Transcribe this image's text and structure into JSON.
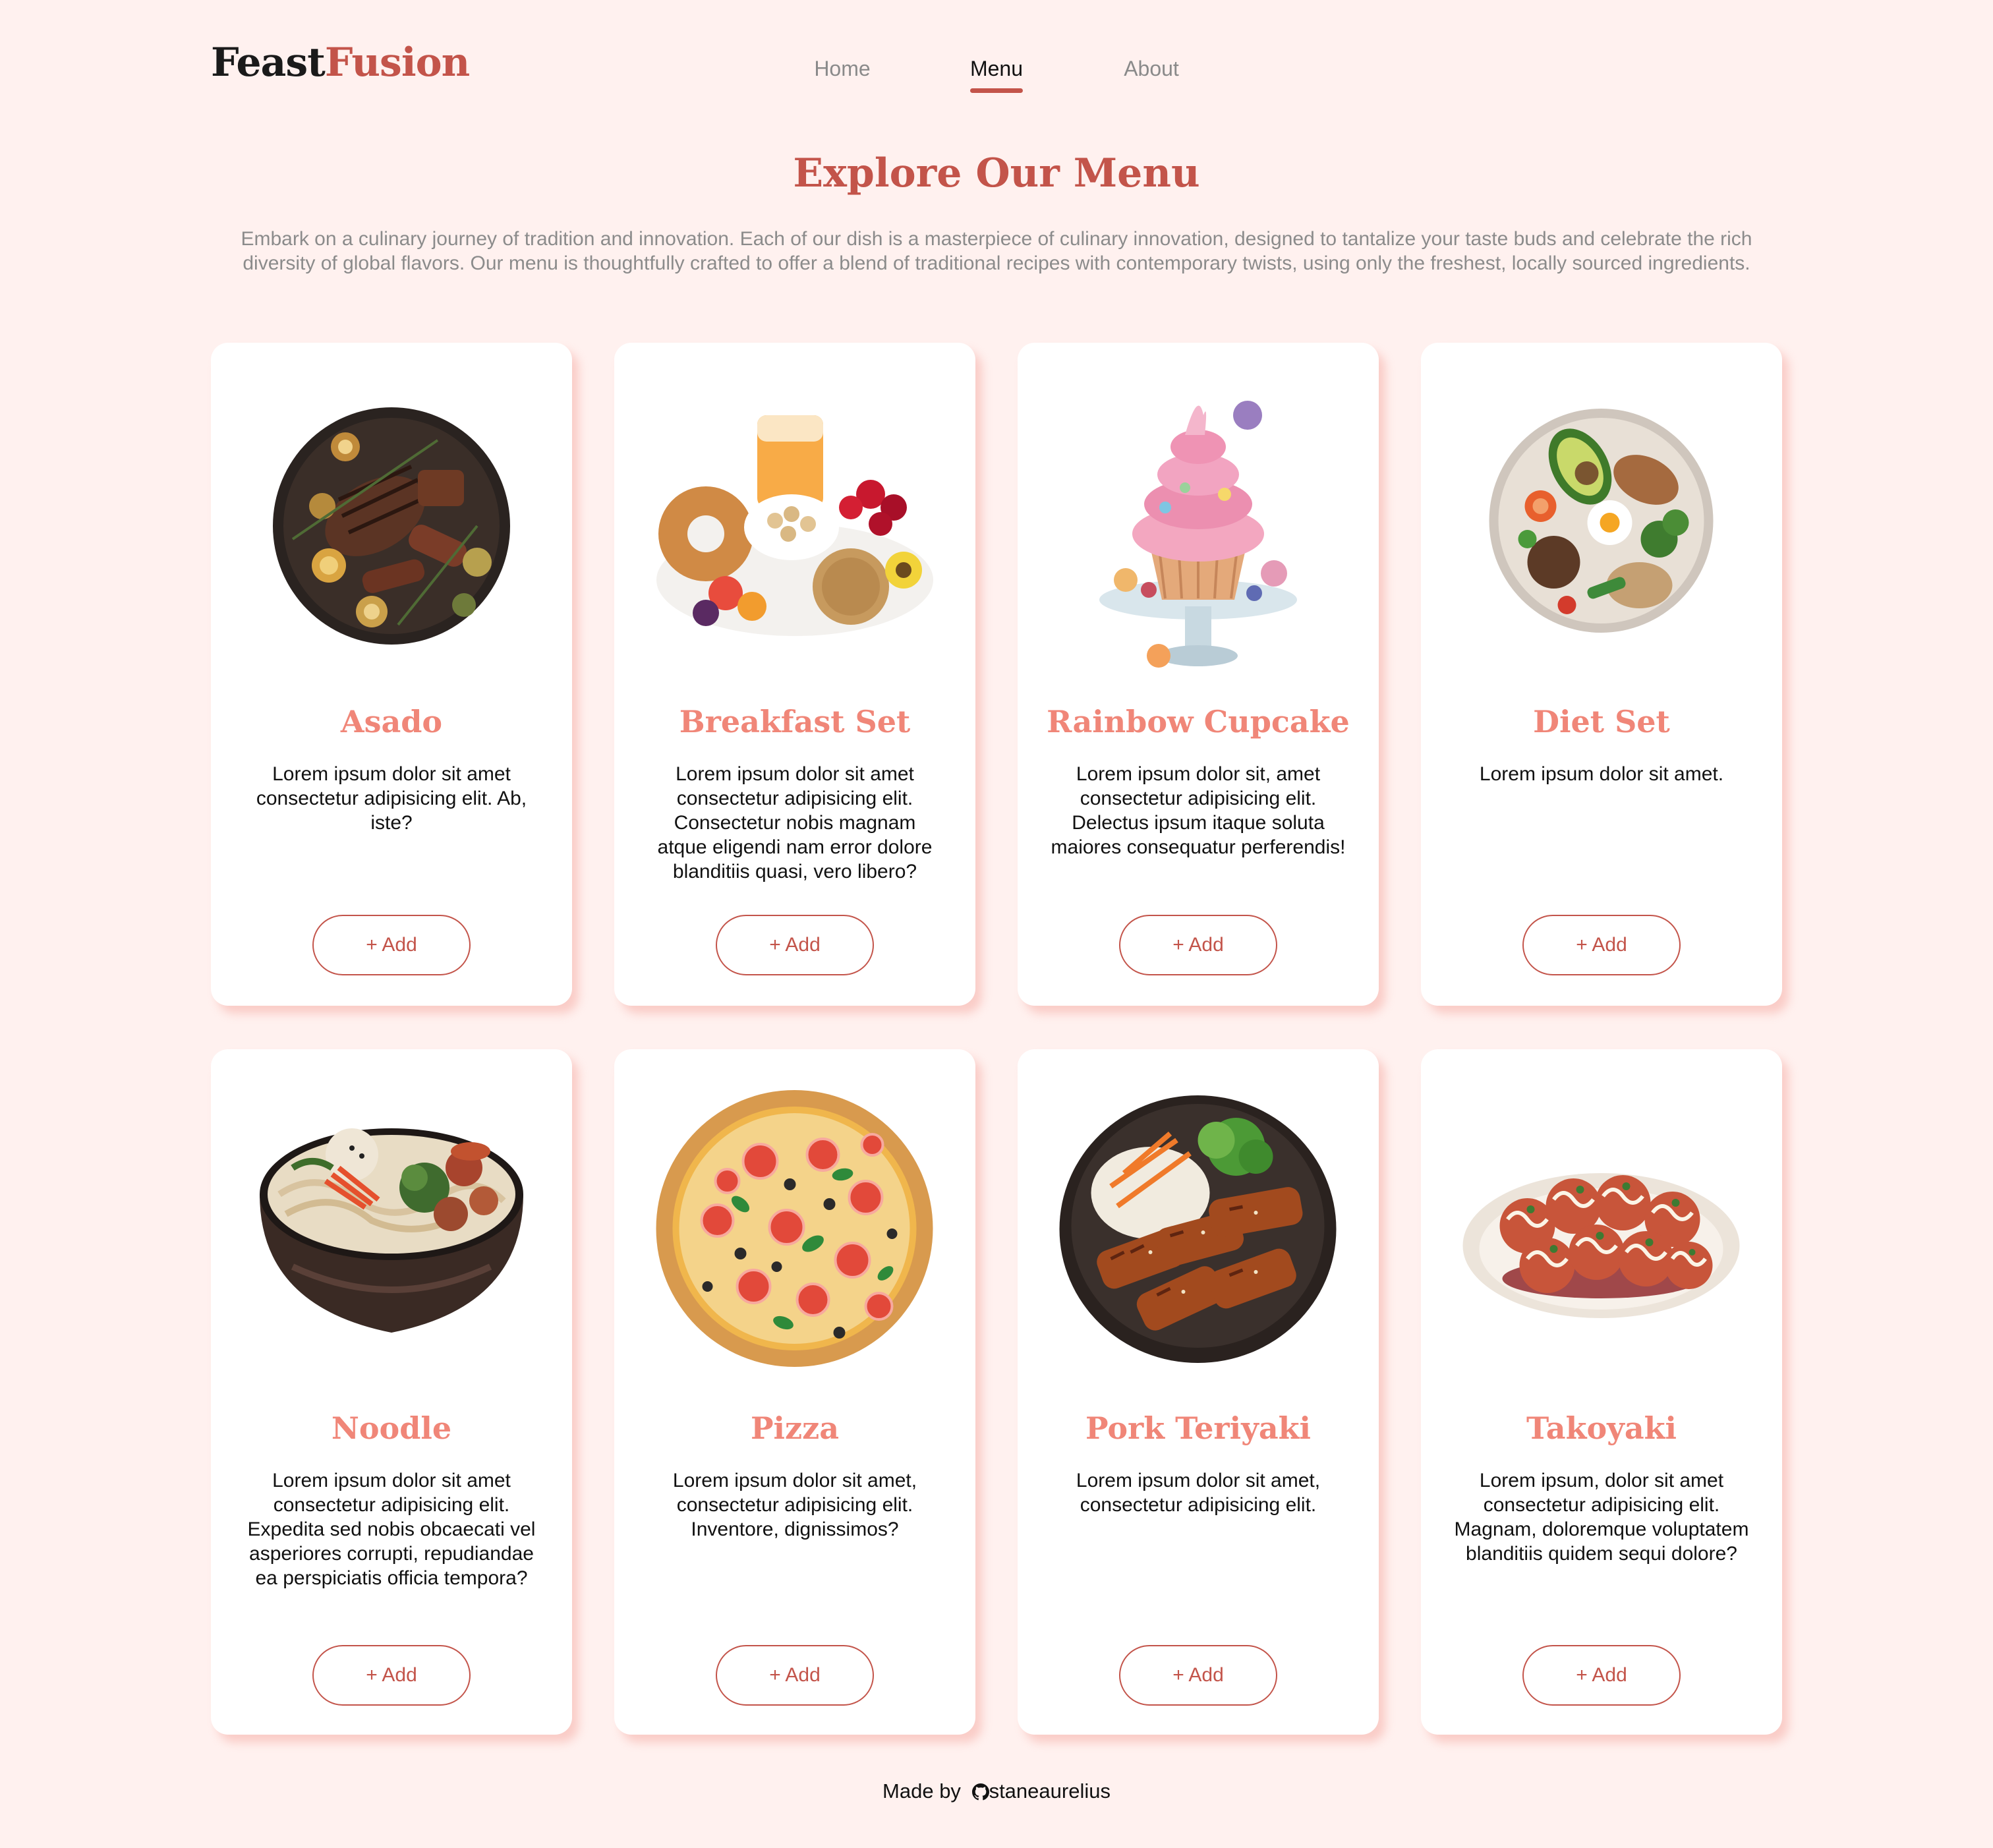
{
  "brand": {
    "part1": "Feast",
    "part2": "Fusion"
  },
  "nav": [
    {
      "label": "Home",
      "active": false
    },
    {
      "label": "Menu",
      "active": true
    },
    {
      "label": "About",
      "active": false
    }
  ],
  "hero": {
    "title": "Explore Our Menu",
    "description": "Embark on a culinary journey of tradition and innovation. Each of our dish is a masterpiece of culinary innovation, designed to tantalize your taste buds and celebrate the rich diversity of global flavors. Our menu is thoughtfully crafted to offer a blend of traditional recipes with contemporary twists, using only the freshest, locally sourced ingredients."
  },
  "menu": [
    {
      "name": "Asado",
      "description": "Lorem ipsum dolor sit amet consectetur adipisicing elit. Ab, iste?",
      "button": "+ Add",
      "image": "grilled-meat-platter"
    },
    {
      "name": "Breakfast Set",
      "description": "Lorem ipsum dolor sit amet consectetur adipisicing elit. Consectetur nobis magnam atque eligendi nam error dolore blanditiis quasi, vero libero?",
      "button": "+ Add",
      "image": "breakfast-platter"
    },
    {
      "name": "Rainbow Cupcake",
      "description": "Lorem ipsum dolor sit, amet consectetur adipisicing elit. Delectus ipsum itaque soluta maiores consequatur perferendis!",
      "button": "+ Add",
      "image": "cupcake-on-stand"
    },
    {
      "name": "Diet Set",
      "description": "Lorem ipsum dolor sit amet.",
      "button": "+ Add",
      "image": "healthy-plate"
    },
    {
      "name": "Noodle",
      "description": "Lorem ipsum dolor sit amet consectetur adipisicing elit. Expedita sed nobis obcaecati vel asperiores corrupti, repudiandae ea perspiciatis officia tempora?",
      "button": "+ Add",
      "image": "noodle-bowl"
    },
    {
      "name": "Pizza",
      "description": "Lorem ipsum dolor sit amet, consectetur adipisicing elit. Inventore, dignissimos?",
      "button": "+ Add",
      "image": "pizza"
    },
    {
      "name": "Pork Teriyaki",
      "description": "Lorem ipsum dolor sit amet, consectetur adipisicing elit.",
      "button": "+ Add",
      "image": "teriyaki-bowl"
    },
    {
      "name": "Takoyaki",
      "description": "Lorem ipsum, dolor sit amet consectetur adipisicing elit. Magnam, doloremque voluptatem blanditiis quidem sequi dolore?",
      "button": "+ Add",
      "image": "takoyaki-plate"
    }
  ],
  "footer": {
    "prefix": "Made by",
    "author": "staneaurelius",
    "icon": "github-icon"
  },
  "colors": {
    "accent": "#c3544a",
    "card_title": "#f08678",
    "background": "#fff1ef",
    "muted_text": "#8b8b8b"
  }
}
